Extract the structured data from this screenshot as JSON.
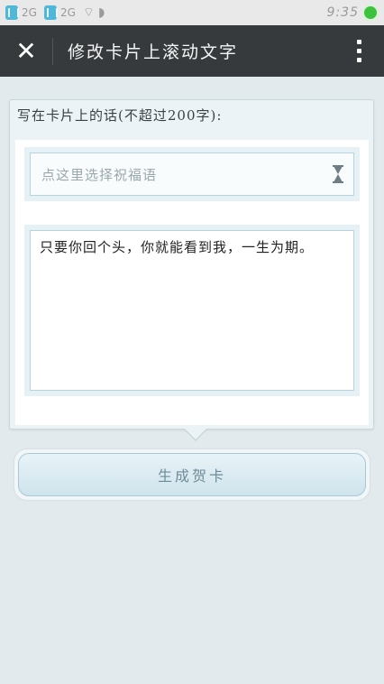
{
  "status_bar": {
    "network_1": "2G",
    "network_2": "2G",
    "time": "9:35"
  },
  "header": {
    "title": "修改卡片上滚动文字"
  },
  "card": {
    "label": "写在卡片上的话(不超过200字):",
    "blessing_select": {
      "placeholder": "点这里选择祝福语"
    },
    "message": {
      "value": "只要你回个头，你就能看到我，一生为期。"
    }
  },
  "actions": {
    "generate_label": "生成贺卡"
  },
  "colors": {
    "header_bg": "#363a3d",
    "page_bg": "#e2eaee",
    "accent": "#6e8c98",
    "battery": "#3cc23c"
  }
}
